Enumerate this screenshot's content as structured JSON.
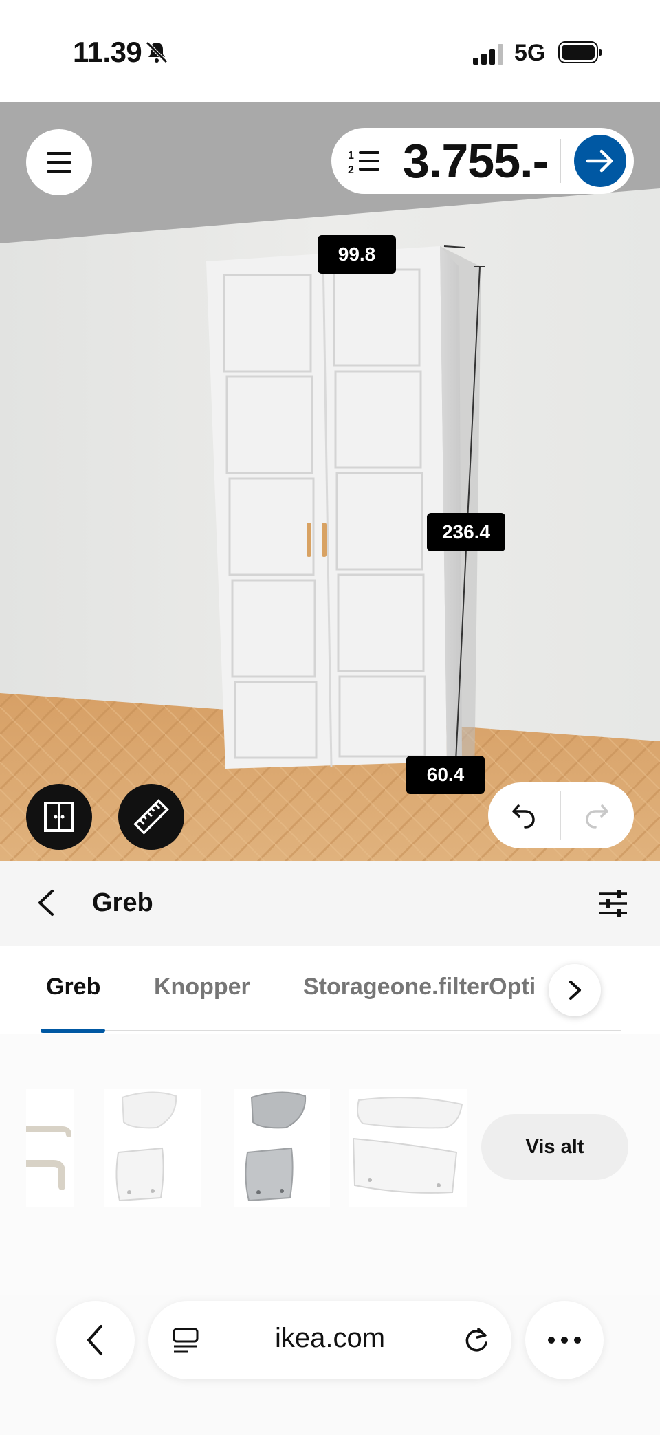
{
  "status_bar": {
    "time": "11.39",
    "network": "5G"
  },
  "planner": {
    "price": "3.755.-",
    "dimensions": {
      "width": "99.8",
      "height": "236.4",
      "depth": "60.4"
    }
  },
  "category": {
    "title": "Greb"
  },
  "tabs": [
    {
      "label": "Greb",
      "active": true
    },
    {
      "label": "Knopper",
      "active": false
    },
    {
      "label": "Storageone.filterOpti",
      "active": false
    }
  ],
  "products": {
    "items": [
      {
        "icon": "bar-handle-icon"
      },
      {
        "icon": "white-cup-handle-icon"
      },
      {
        "icon": "steel-cup-handle-icon"
      },
      {
        "icon": "white-long-handle-icon"
      }
    ],
    "see_all_label": "Vis alt"
  },
  "browser": {
    "url": "ikea.com"
  },
  "colors": {
    "accent_blue": "#0058a3",
    "label_black": "#000000",
    "floor_wood": "#d9a56a"
  }
}
